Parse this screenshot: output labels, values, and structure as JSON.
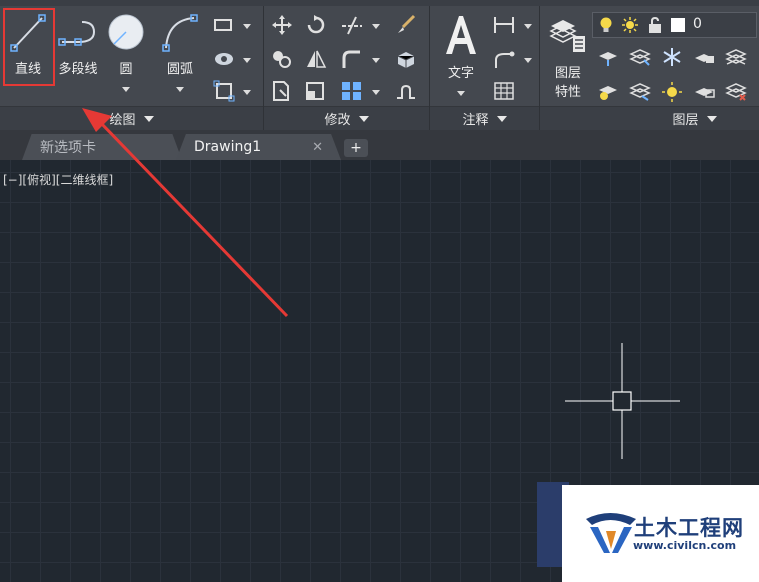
{
  "ribbon": {
    "draw_panel": {
      "title": "绘图",
      "line_label": "直线",
      "polyline_label": "多段线",
      "circle_label": "圆",
      "arc_label": "圆弧"
    },
    "modify_panel": {
      "title": "修改"
    },
    "annotation_panel": {
      "title": "注释",
      "text_label": "文字"
    },
    "layers_panel": {
      "title": "图层",
      "properties_label_line1": "图层",
      "properties_label_line2": "特性",
      "current_layer": "0"
    }
  },
  "tabs": [
    {
      "label": "新选项卡"
    },
    {
      "label": "Drawing1",
      "close": "✕"
    }
  ],
  "tab_add": "+",
  "viewport": {
    "label": "[−][俯视][二维线框]"
  },
  "watermark": {
    "title": "土木工程网",
    "url": "www.civilcn.com"
  },
  "colors": {
    "highlight": "#e53935",
    "canvas_bg": "#212830",
    "ribbon_bg": "#44484f"
  },
  "icons": [
    "line-icon",
    "polyline-icon",
    "circle-icon",
    "arc-icon",
    "move-icon",
    "rotate-icon",
    "trim-icon",
    "text-icon",
    "dimension-icon",
    "table-icon",
    "layer-properties-icon",
    "lightbulb-icon",
    "sun-icon"
  ]
}
